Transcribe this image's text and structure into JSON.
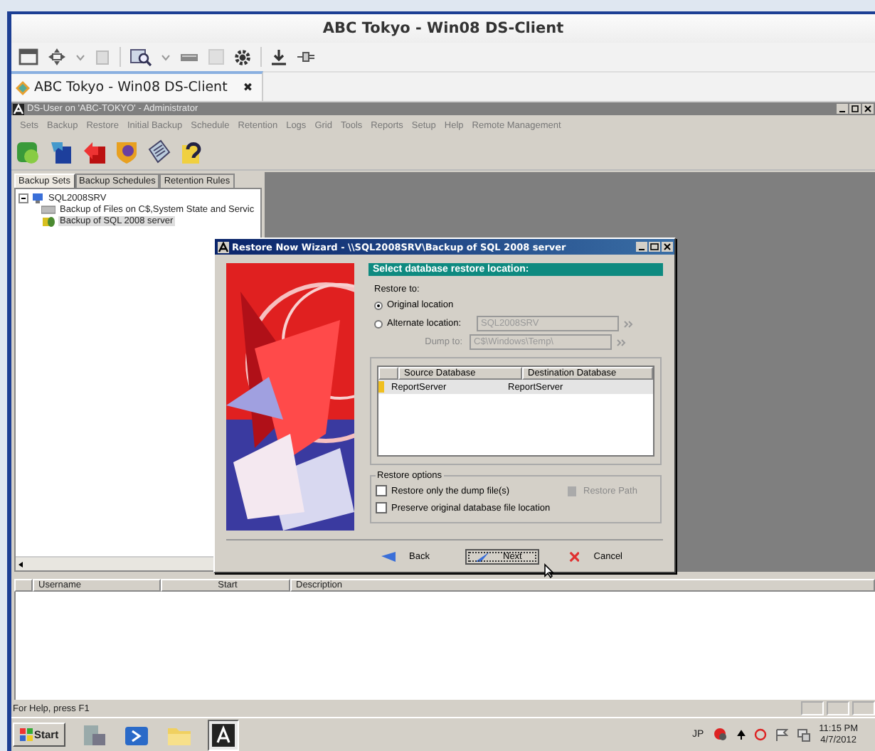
{
  "window": {
    "title": "ABC Tokyo - Win08 DS-Client"
  },
  "browser_tabs": [
    {
      "label": "ABC Tokyo - Win08 DS-Client",
      "close": "✖",
      "selected": true
    }
  ],
  "app": {
    "title": "DS-User on 'ABC-TOKYO' - Administrator",
    "menu": [
      "Sets",
      "Backup",
      "Restore",
      "Initial Backup",
      "Schedule",
      "Retention",
      "Logs",
      "Grid",
      "Tools",
      "Reports",
      "Setup",
      "Help",
      "Remote Management"
    ],
    "panel_tabs": [
      {
        "label": "Backup Sets",
        "selected": true
      },
      {
        "label": "Backup Schedules",
        "selected": false
      },
      {
        "label": "Retention Rules",
        "selected": false
      }
    ],
    "tree": [
      {
        "label": "SQL2008SRV",
        "expanded": true,
        "selected": false,
        "children": [
          {
            "label": "Backup of Files on C$,System State and Servic",
            "kind": "files",
            "selected": false
          },
          {
            "label": "Backup of SQL 2008 server",
            "kind": "database",
            "selected": true
          }
        ]
      }
    ],
    "activity_columns": [
      "Username",
      "Start",
      "Description"
    ],
    "status_bar": "For Help, press F1"
  },
  "dialog": {
    "title": "Restore Now Wizard - \\\\SQL2008SRV\\Backup of SQL 2008 server",
    "heading": "Select database restore location:",
    "restore_to_label": "Restore to:",
    "options": [
      {
        "label": "Original location",
        "selected": true
      },
      {
        "label": "Alternate location:",
        "selected": false
      }
    ],
    "alternate_location": {
      "value": "SQL2008SRV",
      "disabled": true
    },
    "dump_to": {
      "label": "Dump to:",
      "value": "C$\\Windows\\Temp\\",
      "disabled": true
    },
    "columns": [
      "Source Database",
      "Destination Database"
    ],
    "rows": [
      {
        "source": "ReportServer",
        "destination": "ReportServer",
        "selected": true
      }
    ],
    "restore_options_label": "Restore options",
    "checks": [
      {
        "label": "Restore only the dump file(s)",
        "checked": false
      },
      {
        "label": "Preserve original database file location",
        "checked": false
      }
    ],
    "restore_path": {
      "label": "Restore Path",
      "disabled": true
    },
    "buttons": [
      {
        "label": "Back",
        "kind": "back",
        "focused": false
      },
      {
        "label": "Next",
        "kind": "next",
        "focused": true
      },
      {
        "label": "Cancel",
        "kind": "cancel",
        "focused": false
      }
    ]
  },
  "taskbar": {
    "start": "Start",
    "language": "JP",
    "time": "11:15 PM",
    "date": "4/7/2012"
  }
}
